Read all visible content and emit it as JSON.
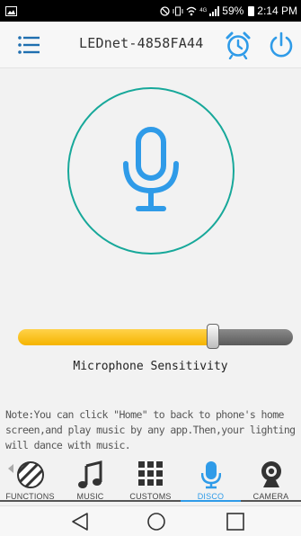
{
  "status_bar": {
    "time": "2:14 PM",
    "battery": "59%",
    "network": "4G"
  },
  "app_bar": {
    "title": "LEDnet-4858FA44"
  },
  "microphone": {
    "sensitivity_label": "Microphone Sensitivity",
    "sensitivity_level": 0.71
  },
  "note": "Note:You can click \"Home\" to back to phone's home screen,and play music by any app.Then,your lighting will dance with music.",
  "tabs": [
    {
      "label": "FUNCTIONS",
      "icon": "functions-icon",
      "active": false
    },
    {
      "label": "MUSIC",
      "icon": "music-note-icon",
      "active": false
    },
    {
      "label": "CUSTOMS",
      "icon": "grid-icon",
      "active": false
    },
    {
      "label": "DISCO",
      "icon": "microphone-icon",
      "active": true
    },
    {
      "label": "CAMERA",
      "icon": "camera-icon",
      "active": false
    }
  ],
  "colors": {
    "accent_blue": "#2f9be8",
    "circle_teal": "#17a89a",
    "slider_fill": "#f5b400"
  }
}
